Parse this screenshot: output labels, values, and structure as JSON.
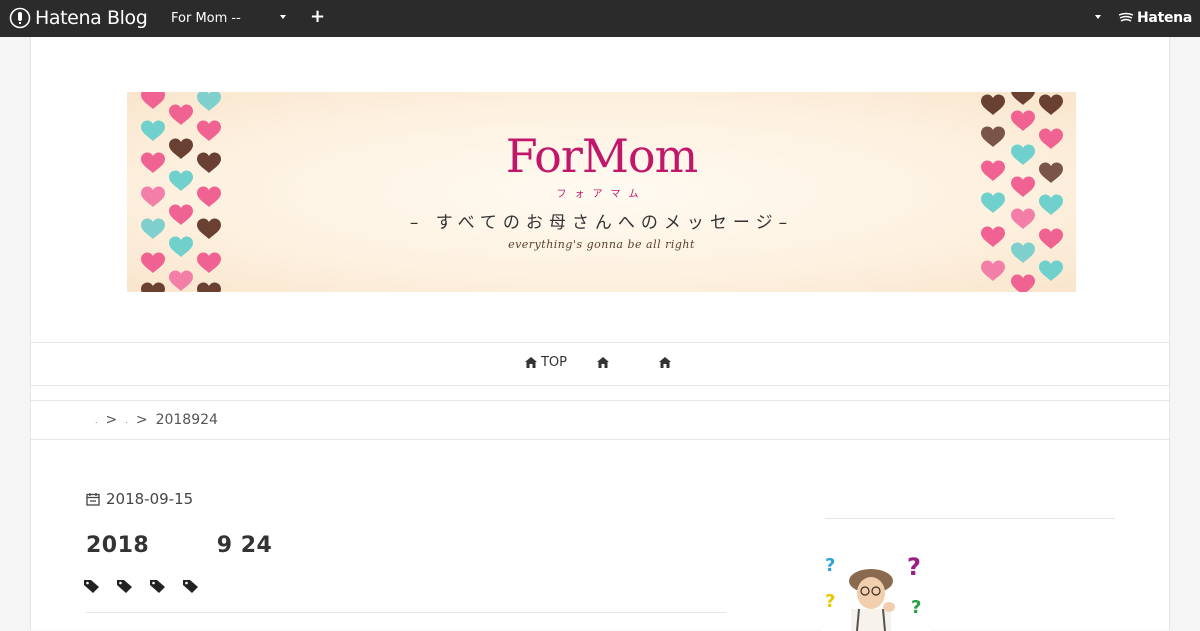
{
  "topbar": {
    "logo_text": "Hatena Blog",
    "blog_name": "For Mom --",
    "hatena_text": "Hatena"
  },
  "banner": {
    "title": "ForMom",
    "kana": "フォアマム",
    "message": "– すべてのお母さんへのメッセージ–",
    "sub": "everything's gonna be all right"
  },
  "nav": {
    "items": [
      {
        "label": "TOP"
      },
      {
        "label": ""
      },
      {
        "label": ""
      }
    ]
  },
  "breadcrumb": {
    "sep": ">",
    "current": "2018924"
  },
  "entry": {
    "date": "2018-09-15",
    "title": "2018　　　9  24",
    "tag_count": 4
  },
  "colors": {
    "topbar": "#2b2b2b",
    "brand": "#c0176a",
    "link": "#1a8fb8"
  }
}
